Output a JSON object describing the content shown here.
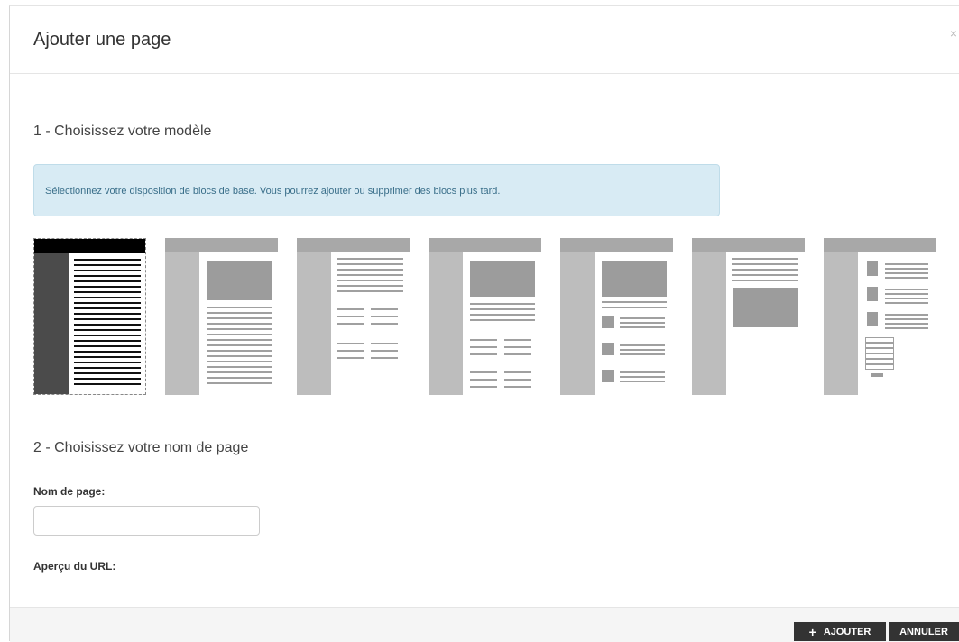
{
  "dialog": {
    "title": "Ajouter une page",
    "close": "×"
  },
  "step1": {
    "heading": "1 - Choisissez votre modèle",
    "info": "Sélectionnez votre disposition de blocs de base. Vous pourrez ajouter ou supprimer des blocs plus tard."
  },
  "templates": {
    "count": 7,
    "selected_index": 0
  },
  "step2": {
    "heading": "2 - Choisissez votre nom de page",
    "name_label": "Nom de page:",
    "name_value": "",
    "url_label": "Aperçu du URL:"
  },
  "footer": {
    "add_icon": "plus-icon",
    "add_label": "AJOUTER",
    "cancel_label": "ANNULER"
  }
}
